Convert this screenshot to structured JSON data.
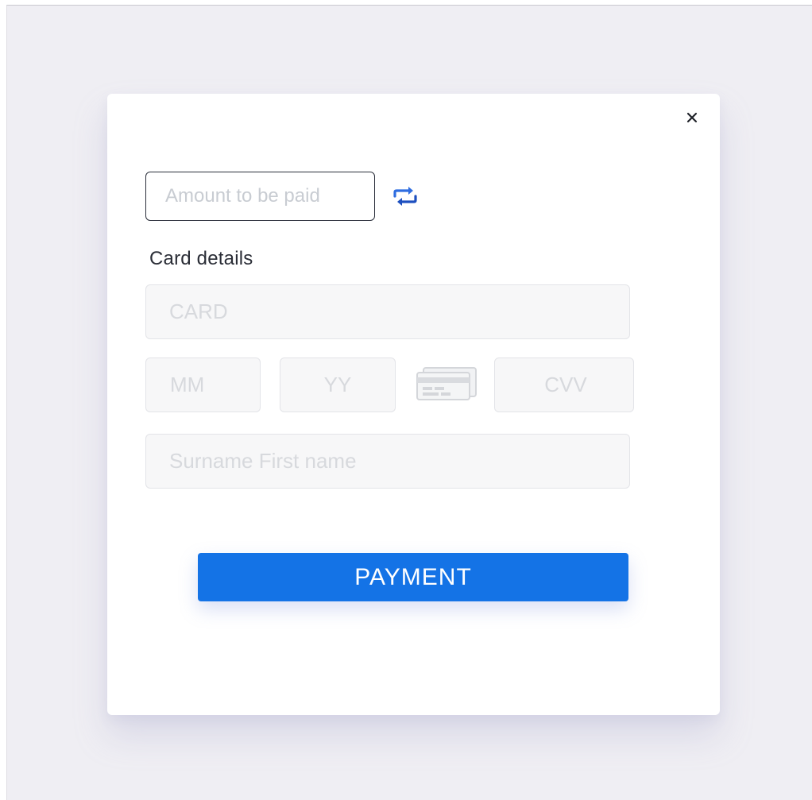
{
  "close": {
    "icon": "close-icon",
    "glyph": "×"
  },
  "amount": {
    "value": "",
    "placeholder": "Amount to be paid"
  },
  "swap": {
    "icon": "swap-arrows-icon",
    "color": "#2f6de0"
  },
  "card_details": {
    "label": "Card details",
    "card_number": {
      "value": "",
      "placeholder": "CARD"
    },
    "month": {
      "value": "",
      "placeholder": "MM"
    },
    "year": {
      "value": "",
      "placeholder": "YY"
    },
    "card_icon": "card-back-icon",
    "cvv": {
      "value": "",
      "placeholder": "CVV"
    },
    "cardholder": {
      "value": "",
      "placeholder": "Surname First name"
    }
  },
  "payment_button": {
    "label": "PAYMENT",
    "color": "#1473e6"
  }
}
